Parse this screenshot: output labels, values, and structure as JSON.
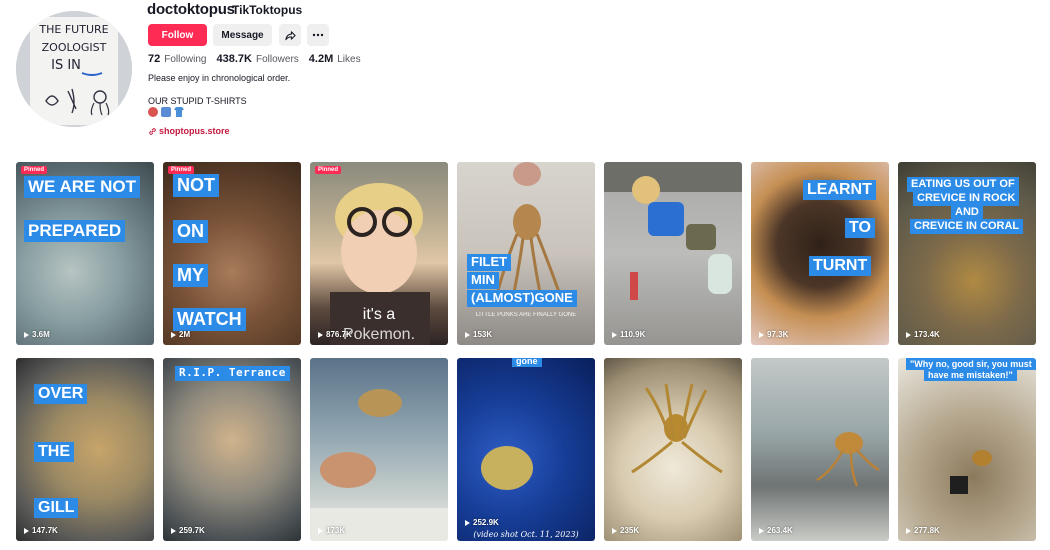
{
  "profile": {
    "username": "doctoktopus",
    "nickname": "TikToktopus",
    "follow_label": "Follow",
    "message_label": "Message",
    "stats": {
      "following": "72",
      "following_label": "Following",
      "followers": "438.7K",
      "followers_label": "Followers",
      "likes": "4.2M",
      "likes_label": "Likes"
    },
    "bio_line1": "Please enjoy in chronological order.",
    "bio_line2": "OUR STUPID T-SHIRTS",
    "link": "shoptopus.store",
    "avatar_text": [
      "THE FUTURE",
      "ZOOLOGIST",
      "IS IN"
    ]
  },
  "colors": {
    "accent": "#fe2c55",
    "caption": "#2d8be8",
    "link": "#c3183e"
  },
  "videos": [
    {
      "views": "3.6M",
      "pinned": "Pinned",
      "captions": [
        "WE ARE NOT",
        "PREPARED"
      ]
    },
    {
      "views": "2M",
      "pinned": "Pinned",
      "captions": [
        "NOT",
        "ON",
        "MY",
        "WATCH"
      ]
    },
    {
      "views": "876.7K",
      "pinned": "Pinned",
      "captions": [
        "it's a",
        "Pokemon."
      ]
    },
    {
      "views": "153K",
      "captions": [
        "FILET",
        "MIN",
        "(ALMOST)GONE"
      ],
      "subtitle": "LITTLE PUNKS ARE FINALLY GONE"
    },
    {
      "views": "110.9K",
      "captions": []
    },
    {
      "views": "97.3K",
      "captions": [
        "LEARNT",
        "TO",
        "TURNT"
      ]
    },
    {
      "views": "173.4K",
      "captions": [
        "EATING US OUT OF",
        "CREVICE IN ROCK",
        "AND",
        "CREVICE IN CORAL"
      ]
    },
    {
      "views": "147.7K",
      "captions": [
        "OVER",
        "THE",
        "GILL"
      ]
    },
    {
      "views": "259.7K",
      "captions": [
        "R.I.P. Terrance"
      ]
    },
    {
      "views": "173K",
      "captions": []
    },
    {
      "views": "252.9K",
      "captions": [
        "gone",
        "(video shot Oct. 11, 2023)"
      ]
    },
    {
      "views": "235K",
      "captions": []
    },
    {
      "views": "263.4K",
      "captions": []
    },
    {
      "views": "277.8K",
      "captions": [
        "\"Why no, good sir, you must",
        "have me mistaken!\""
      ]
    }
  ]
}
